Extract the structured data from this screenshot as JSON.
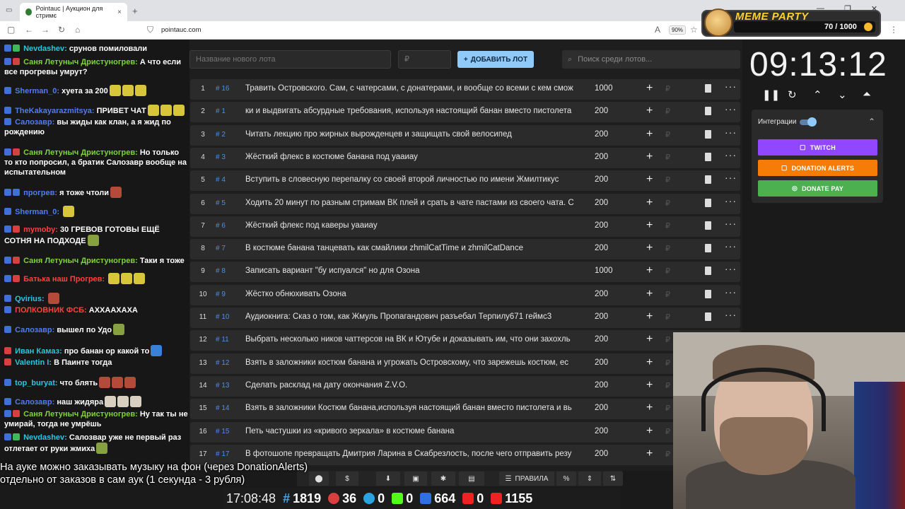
{
  "browser": {
    "tab_title": "Pointauc | Аукцион для стримє",
    "tab_close": "×",
    "new_tab": "+",
    "url": "pointauc.com",
    "zoom": "90%",
    "window_controls": [
      "—",
      "❐",
      "✕"
    ]
  },
  "meme_party": {
    "title": "MEME PARTY",
    "count": "70 / 1000"
  },
  "chat": [
    {
      "name": "Nevdashev:",
      "text": "срунов помиловали",
      "name_color": "cyan"
    },
    {
      "name": "Саня Летуныч Дристуногрев:",
      "text": "А что если все прогревы умрут?",
      "name_color": "green"
    },
    {
      "name": "Sherman_0:",
      "text": "хуета за 200",
      "name_color": "blue"
    },
    {
      "name": "TheKakayarazmitsya:",
      "text": "ПРИВЕТ ЧАТ",
      "name_color": "blue"
    },
    {
      "name": "Салозавр:",
      "text": "вы жиды как клан, а я жид по рождению",
      "name_color": "blue"
    },
    {
      "name": "Саня Летуныч Дристуногрев:",
      "text": "Но только то кто попросил, а братик Салозавр вообще на испытательном",
      "name_color": "green"
    },
    {
      "name": "прогрев:",
      "text": "я тоже чтоли",
      "name_color": "blue"
    },
    {
      "name": "Sherman_0:",
      "text": "",
      "name_color": "blue"
    },
    {
      "name": "mymoby:",
      "text": "30 ГРЕВОВ ГОТОВЫ ЕЩЁ СОТНЯ НА ПОДХОДЕ",
      "name_color": "red"
    },
    {
      "name": "Саня Летуныч Дристуногрев:",
      "text": "Таки я тоже",
      "name_color": "green"
    },
    {
      "name": "Батька наш Прогрев:",
      "text": "",
      "name_color": "red"
    },
    {
      "name": "Qvirius:",
      "text": "",
      "name_color": "cyan"
    },
    {
      "name": "ПОЛКОВНИК ФСБ:",
      "text": "АХХААХАХА",
      "name_color": "red"
    },
    {
      "name": "Салозавр:",
      "text": "вышел по Удо",
      "name_color": "blue"
    },
    {
      "name": "Иван Камаз:",
      "text": "про банан ор какой то",
      "name_color": "cyan"
    },
    {
      "name": "Valentin I:",
      "text": "В Паинте тогда",
      "name_color": "cyan"
    },
    {
      "name": "top_buryat:",
      "text": "что блять",
      "name_color": "cyan"
    },
    {
      "name": "Салозавр:",
      "text": "наш жидяра",
      "name_color": "blue"
    },
    {
      "name": "Саня Летуныч Дристуногрев:",
      "text": "Ну так ты не умирай, тогда не умрёшь",
      "name_color": "green"
    },
    {
      "name": "Nevdashev:",
      "text": "Салозвар уже не первый раз отлетает от руки жмиха",
      "name_color": "cyan"
    }
  ],
  "auction": {
    "name_placeholder": "Название нового лота",
    "price_placeholder": "₽",
    "add_label": "ДОБАВИТЬ ЛОТ",
    "search_placeholder": "Поиск среди лотов...",
    "currency": "₽",
    "lots": [
      {
        "idx": "1",
        "id": "# 16",
        "title": "Травить Островского. Сам, с чатерсами, с донатерами, и вообще со всеми с кем смож",
        "amount": "1000"
      },
      {
        "idx": "2",
        "id": "# 1",
        "title": "ки и выдвигать абсурдные требования, используя настоящий банан вместо пистолета",
        "amount": "200"
      },
      {
        "idx": "3",
        "id": "# 2",
        "title": "Читать лекцию про жирных вырожденцев и защищать свой велосипед",
        "amount": "200"
      },
      {
        "idx": "4",
        "id": "# 3",
        "title": "Жёсткий флекс в костюме банана под уааиау",
        "amount": "200"
      },
      {
        "idx": "5",
        "id": "# 4",
        "title": "Вступить в словесную перепалку со своей второй личностью по имени Жмилтикус",
        "amount": "200"
      },
      {
        "idx": "6",
        "id": "# 5",
        "title": "Ходить 20 минут по разным стримам ВК плей и срать в чате пастами из своего чата. С",
        "amount": "200"
      },
      {
        "idx": "7",
        "id": "# 6",
        "title": "Жёсткий флекс под каверы уааиау",
        "amount": "200"
      },
      {
        "idx": "8",
        "id": "# 7",
        "title": "В костюме банана танцевать как смайлики zhmilCatTime и zhmilCatDance",
        "amount": "200"
      },
      {
        "idx": "9",
        "id": "# 8",
        "title": "Записать вариант \"бу испуался\" но для Озона",
        "amount": "1000"
      },
      {
        "idx": "10",
        "id": "# 9",
        "title": "Жёстко обнюхивать Озона",
        "amount": "200"
      },
      {
        "idx": "11",
        "id": "# 10",
        "title": "Аудиокнига: Сказ о том, как Жмуль Пропагандович разъебал Терпилу671 геймс3",
        "amount": "200"
      },
      {
        "idx": "12",
        "id": "# 11",
        "title": "Выбрать несколько ников чаттерсов на ВК и Ютубе и доказывать им, что они захохль",
        "amount": "200"
      },
      {
        "idx": "13",
        "id": "# 12",
        "title": "Взять в заложники костюм банана и угрожать Островскому, что зарежешь костюм, ес",
        "amount": "200"
      },
      {
        "idx": "14",
        "id": "# 13",
        "title": "Сделать расклад на дату окончания Z.V.O.",
        "amount": "200"
      },
      {
        "idx": "15",
        "id": "# 14",
        "title": "Взять в заложники Костюм банана,используя настоящий банан вместо пистолета и вь",
        "amount": "200"
      },
      {
        "idx": "16",
        "id": "# 15",
        "title": "Петь частушки из «кривого зеркала» в костюме банана",
        "amount": "200"
      },
      {
        "idx": "17",
        "id": "# 17",
        "title": "В фотошопе превращать Дмитрия Ларина в Скабрезлость, после чего отправить резу",
        "amount": "200"
      }
    ]
  },
  "bottom_bar": {
    "rules_label": "ПРАВИЛА",
    "percent": "%"
  },
  "timer": {
    "value": "09:13:12",
    "integrations_label": "Интеграции",
    "twitch_label": "TWITCH",
    "donation_alerts_label": "DONATION ALERTS",
    "donate_pay_label": "DONATE PAY"
  },
  "subtitle": {
    "line1": "На ауке можно заказывать музыку на фон (через DonationAlerts)",
    "line2": "отдельно от заказов в сам аук (1 секунда - 3 рубля)"
  },
  "stats": {
    "clock": "17:08:48",
    "hash": "1819",
    "red": "36",
    "telegram": "0",
    "kick": "0",
    "vk": "664",
    "youtube": "0",
    "youtube2": "1155"
  },
  "colors": {
    "accent_blue": "#90caf9",
    "twitch": "#9146ff",
    "donation_alerts": "#f57d07",
    "donate_pay": "#4caf50"
  }
}
